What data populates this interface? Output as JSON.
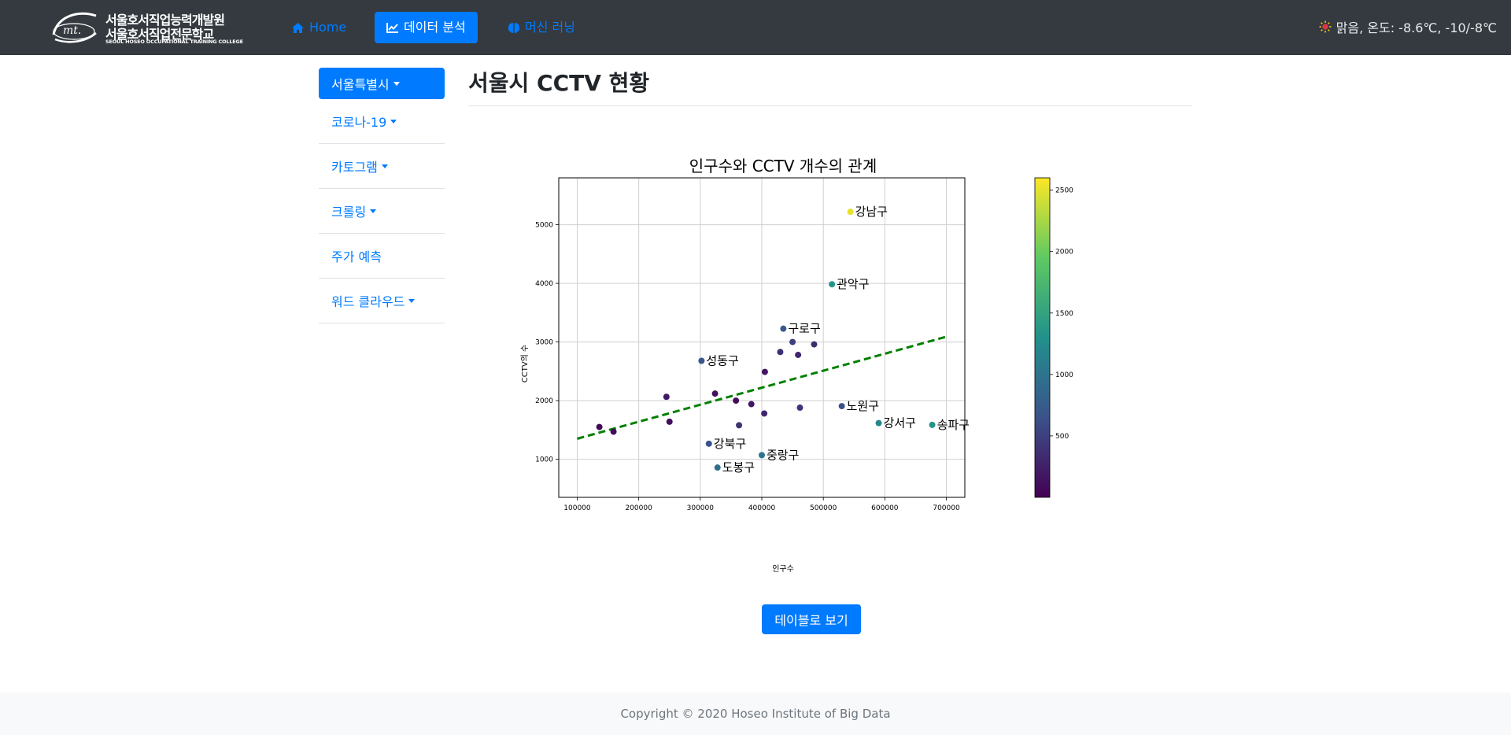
{
  "brand": {
    "line1": "서울호서직업능력개발원",
    "line2": "서울호서직업전문학교",
    "line3": "SEOUL HOSEO OCCUPATIONAL TRAINING COLLEGE",
    "logo_icon": "mt-swoosh-logo"
  },
  "nav": {
    "items": [
      {
        "label": "Home",
        "icon": "home-icon",
        "active": false
      },
      {
        "label": "데이터 분석",
        "icon": "line-chart-icon",
        "active": true
      },
      {
        "label": "머신 러닝",
        "icon": "brain-icon",
        "active": false
      }
    ]
  },
  "weather": {
    "icon": "sun-icon",
    "text": "맑음, 온도: -8.6℃, -10/-8℃"
  },
  "sidebar": {
    "items": [
      {
        "label": "서울특별시",
        "dropdown": true,
        "active": true
      },
      {
        "label": "코로나-19",
        "dropdown": true,
        "active": false
      },
      {
        "label": "카토그램",
        "dropdown": true,
        "active": false
      },
      {
        "label": "크롤링",
        "dropdown": true,
        "active": false
      },
      {
        "label": "주가 예측",
        "dropdown": false,
        "active": false
      },
      {
        "label": "워드 클라우드",
        "dropdown": true,
        "active": false
      }
    ]
  },
  "main": {
    "title": "서울시 CCTV 현황",
    "table_button": "테이블로 보기"
  },
  "footer": {
    "text": "Copyright © 2020 Hoseo Institute of Big Data"
  },
  "colors": {
    "navbar_bg": "#343a40",
    "primary": "#007bff",
    "trend_line": "#008000"
  },
  "chart_data": {
    "type": "scatter",
    "title": "인구수와 CCTV 개수의 관계",
    "xlabel": "인구수",
    "ylabel": "CCTV의 수",
    "xlim": [
      70000,
      730000
    ],
    "ylim": [
      350,
      5800
    ],
    "xticks": [
      100000,
      200000,
      300000,
      400000,
      500000,
      600000,
      700000
    ],
    "yticks": [
      1000,
      2000,
      3000,
      4000,
      5000
    ],
    "grid": true,
    "colorbar": {
      "colormap": "viridis",
      "range": [
        0,
        2600
      ],
      "ticks": [
        500,
        1000,
        1500,
        2000,
        2500
      ]
    },
    "trend_line": {
      "style": "dashed",
      "color": "green",
      "points": [
        [
          100000,
          1350
        ],
        [
          700000,
          3090
        ]
      ]
    },
    "points": [
      {
        "x": 544000,
        "y": 5221,
        "label": "강남구",
        "c": 2500
      },
      {
        "x": 514000,
        "y": 3985,
        "label": "관악구",
        "c": 1330
      },
      {
        "x": 435000,
        "y": 3227,
        "label": "구로구",
        "c": 720
      },
      {
        "x": 302000,
        "y": 2679,
        "label": "성동구",
        "c": 700
      },
      {
        "x": 530000,
        "y": 1906,
        "label": "노원구",
        "c": 640
      },
      {
        "x": 590000,
        "y": 1617,
        "label": "강서구",
        "c": 1200
      },
      {
        "x": 677000,
        "y": 1586,
        "label": "송파구",
        "c": 1330
      },
      {
        "x": 314000,
        "y": 1265,
        "label": "강북구",
        "c": 650
      },
      {
        "x": 400000,
        "y": 1070,
        "label": "중랑구",
        "c": 1000
      },
      {
        "x": 328000,
        "y": 858,
        "label": "도봉구",
        "c": 950
      },
      {
        "x": 450000,
        "y": 3000,
        "label": "",
        "c": 500
      },
      {
        "x": 485000,
        "y": 2960,
        "label": "",
        "c": 350
      },
      {
        "x": 430000,
        "y": 2830,
        "label": "",
        "c": 380
      },
      {
        "x": 459000,
        "y": 2780,
        "label": "",
        "c": 300
      },
      {
        "x": 405000,
        "y": 2490,
        "label": "",
        "c": 150
      },
      {
        "x": 245000,
        "y": 2065,
        "label": "",
        "c": 200
      },
      {
        "x": 324000,
        "y": 2120,
        "label": "",
        "c": 120
      },
      {
        "x": 358000,
        "y": 2000,
        "label": "",
        "c": 100
      },
      {
        "x": 383000,
        "y": 1940,
        "label": "",
        "c": 180
      },
      {
        "x": 462000,
        "y": 1880,
        "label": "",
        "c": 420
      },
      {
        "x": 404000,
        "y": 1780,
        "label": "",
        "c": 300
      },
      {
        "x": 363000,
        "y": 1580,
        "label": "",
        "c": 390
      },
      {
        "x": 250000,
        "y": 1640,
        "label": "",
        "c": 100
      },
      {
        "x": 136000,
        "y": 1550,
        "label": "",
        "c": 60
      },
      {
        "x": 159000,
        "y": 1470,
        "label": "",
        "c": 100
      }
    ]
  }
}
